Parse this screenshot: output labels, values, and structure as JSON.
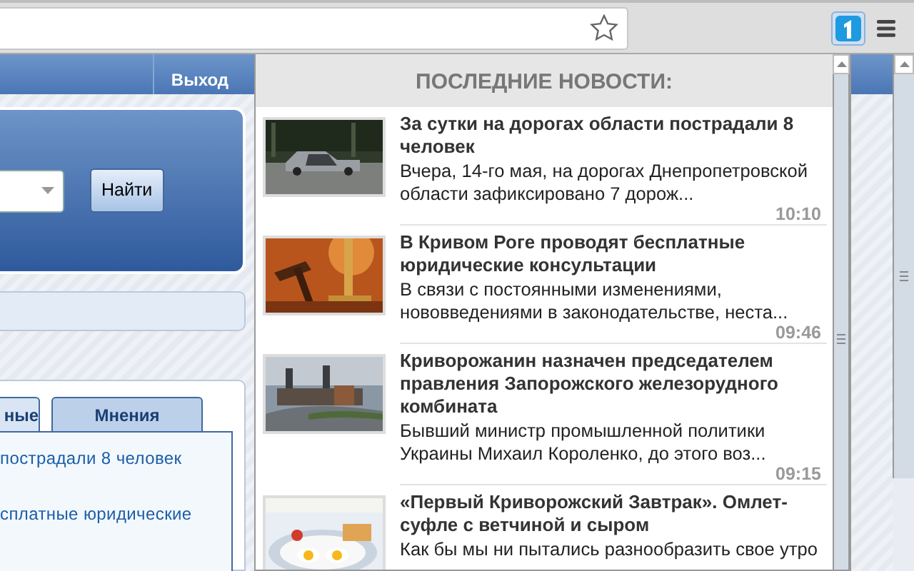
{
  "page": {
    "logout": "Выход",
    "search_button": "Найти",
    "tabs": [
      {
        "label": "ные",
        "selected": true
      },
      {
        "label": "Мнения",
        "selected": false
      }
    ],
    "links": [
      "пострадали 8 человек",
      "сплатные юридические"
    ]
  },
  "popup": {
    "title": "ПОСЛЕДНИЕ НОВОСТИ:",
    "news": [
      {
        "title": "За сутки на дорогах области пострадали 8 человек",
        "summary": "Вчера, 14-го мая, на дорогах Днепропетровской области зафиксировано 7 дорож...",
        "time": "10:10"
      },
      {
        "title": "В Кривом Роге проводят бесплатные юридические консультации",
        "summary": "В связи с постоянными изменениями, нововведениями в законодательстве, неста...",
        "time": "09:46"
      },
      {
        "title": "Криворожанин назначен председателем правления Запорожского железорудного комбината",
        "summary": "Бывший министр промышленной политики Украины Михаил Короленко, до этого воз...",
        "time": "09:15"
      },
      {
        "title": "«Первый Криворожский Завтрак». Омлет-суфле с ветчиной и сыром",
        "summary": "Как бы мы ни пытались разнообразить свое утро"
      }
    ]
  }
}
